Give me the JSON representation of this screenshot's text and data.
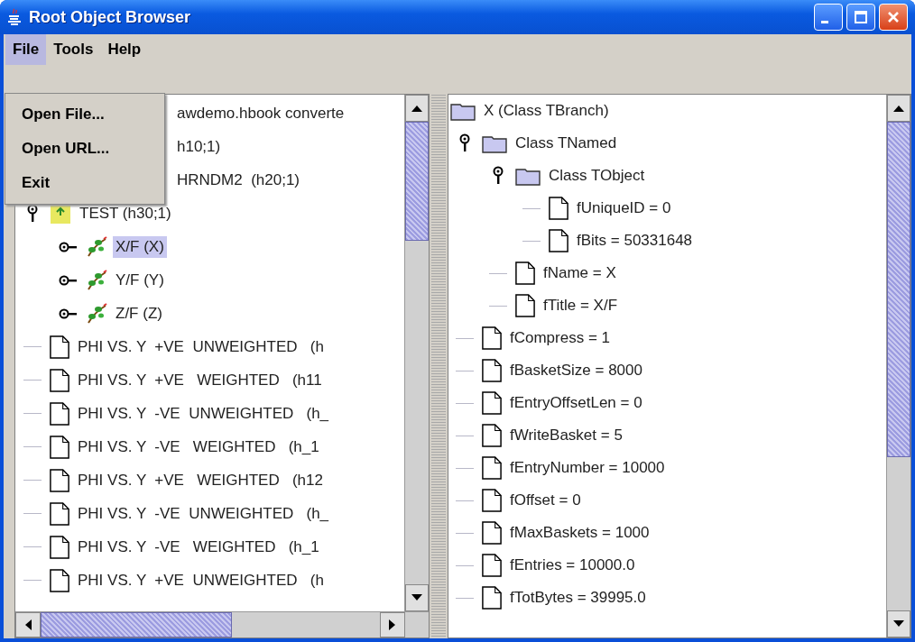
{
  "window": {
    "title": "Root Object Browser"
  },
  "menu_bar": [
    {
      "label": "File",
      "selected": true
    },
    {
      "label": "Tools",
      "selected": false
    },
    {
      "label": "Help",
      "selected": false
    }
  ],
  "file_menu": [
    "Open File...",
    "Open URL...",
    "Exit"
  ],
  "object_tree": [
    {
      "text": "awdemo.hbook converte",
      "kind": "covered",
      "selected": false
    },
    {
      "text": "h10;1)",
      "kind": "covered",
      "selected": false
    },
    {
      "text": "HRNDM2  (h20;1)",
      "kind": "covered",
      "selected": false
    },
    {
      "text": "TEST (h30;1)",
      "kind": "directory",
      "expanded": true,
      "selected": false,
      "children": [
        {
          "text": "X/F (X)",
          "kind": "branch",
          "expanded": false,
          "selected": true
        },
        {
          "text": "Y/F (Y)",
          "kind": "branch",
          "expanded": false,
          "selected": false
        },
        {
          "text": "Z/F (Z)",
          "kind": "branch",
          "expanded": false,
          "selected": false
        }
      ]
    },
    {
      "text": "PHI VS. Y  +VE  UNWEIGHTED   (h",
      "kind": "file",
      "selected": false
    },
    {
      "text": "PHI VS. Y  +VE   WEIGHTED   (h11",
      "kind": "file",
      "selected": false
    },
    {
      "text": "PHI VS. Y  -VE  UNWEIGHTED   (h_",
      "kind": "file",
      "selected": false
    },
    {
      "text": "PHI VS. Y  -VE   WEIGHTED   (h_1",
      "kind": "file",
      "selected": false
    },
    {
      "text": "PHI VS. Y  +VE   WEIGHTED   (h12",
      "kind": "file",
      "selected": false
    },
    {
      "text": "PHI VS. Y  -VE  UNWEIGHTED   (h_",
      "kind": "file",
      "selected": false
    },
    {
      "text": "PHI VS. Y  -VE   WEIGHTED   (h_1",
      "kind": "file",
      "selected": false
    },
    {
      "text": "PHI VS. Y  +VE  UNWEIGHTED   (h",
      "kind": "file",
      "selected": false
    }
  ],
  "detail_tree": [
    {
      "text": "X (Class TBranch)",
      "kind": "folder",
      "selected": false,
      "children": [
        {
          "text": "Class TNamed",
          "kind": "folder",
          "expanded": true,
          "selected": false,
          "children": [
            {
              "text": "Class TObject",
              "kind": "folder",
              "expanded": true,
              "selected": false,
              "children": [
                {
                  "text": "fUniqueID = 0",
                  "kind": "file",
                  "selected": false
                },
                {
                  "text": "fBits = 50331648",
                  "kind": "file",
                  "selected": false
                }
              ]
            },
            {
              "text": "fName = X",
              "kind": "file",
              "selected": false
            },
            {
              "text": "fTitle = X/F",
              "kind": "file",
              "selected": false
            }
          ]
        },
        {
          "text": "fCompress = 1",
          "kind": "file",
          "selected": false
        },
        {
          "text": "fBasketSize = 8000",
          "kind": "file",
          "selected": false
        },
        {
          "text": "fEntryOffsetLen = 0",
          "kind": "file",
          "selected": false
        },
        {
          "text": "fWriteBasket = 5",
          "kind": "file",
          "selected": false
        },
        {
          "text": "fEntryNumber = 10000",
          "kind": "file",
          "selected": false
        },
        {
          "text": "fOffset = 0",
          "kind": "file",
          "selected": false
        },
        {
          "text": "fMaxBaskets = 1000",
          "kind": "file",
          "selected": false
        },
        {
          "text": "fEntries = 10000.0",
          "kind": "file",
          "selected": false
        },
        {
          "text": "fTotBytes = 39995.0",
          "kind": "file",
          "selected": false
        }
      ]
    }
  ]
}
